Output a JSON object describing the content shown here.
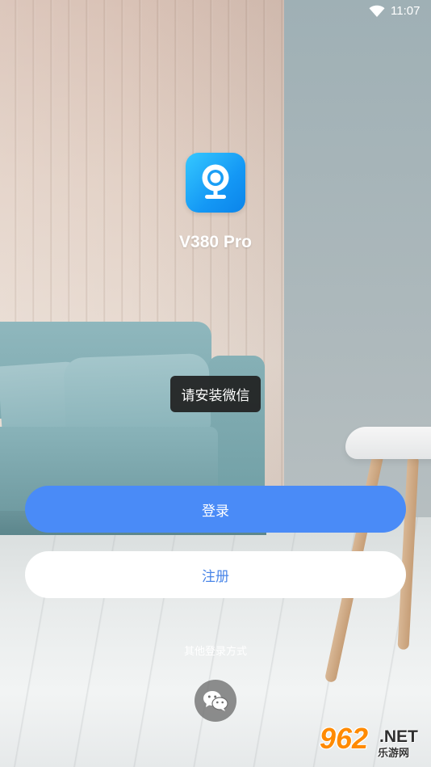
{
  "status_bar": {
    "time": "11:07",
    "wifi_icon": "wifi-icon"
  },
  "app": {
    "name": "V380 Pro",
    "logo_icon": "camera-icon",
    "logo_colors": [
      "#35c8ff",
      "#0b84ea"
    ]
  },
  "toast": {
    "message": "请安装微信"
  },
  "actions": {
    "login_label": "登录",
    "register_label": "注册",
    "login_color": "#4a8bf7",
    "register_text_color": "#4a86e8"
  },
  "other_login": {
    "label": "其他登录方式",
    "methods": [
      {
        "icon": "wechat-icon"
      }
    ]
  },
  "watermark": {
    "brand": "962",
    "suffix": ".NET",
    "subtitle": "乐游网"
  }
}
